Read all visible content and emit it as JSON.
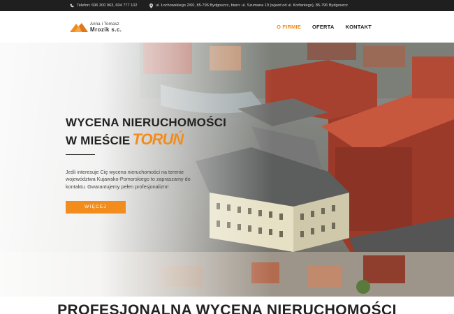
{
  "topbar": {
    "phone_text": "Telefon: 696 300 963, 604 777 102",
    "address_text": "ul. Łochowskiego 2/60, 85-796 Bydgoszcz, biuro: ul. Szumana 19 (wjazd od ul. Korfantego), 85-796 Bydgoszcz"
  },
  "logo": {
    "line1": "Anna i Tomasz",
    "line2": "Mrozik s.c."
  },
  "nav": {
    "items": [
      {
        "label": "O FIRMIE",
        "active": true
      },
      {
        "label": "OFERTA",
        "active": false
      },
      {
        "label": "KONTAKT",
        "active": false
      }
    ]
  },
  "hero": {
    "title_line1": "WYCENA NIERUCHOMOŚCI",
    "title_line2": "W MIEŚCIE",
    "city": "TORUŃ",
    "description": "Jeśli interesuje Cię wycena nieruchomości na terenie województwa Kujawsko-Pomorskiego to zapraszamy do kontaktu. Gwarantujemy pełen profesjonalizm!",
    "button_label": "WIĘCEJ"
  },
  "section": {
    "title": "PROFESJONALNA WYCENA NIERUCHOMOŚCI"
  },
  "colors": {
    "accent": "#f28c1c",
    "topbar_bg": "#1f1f1f",
    "text_dark": "#222222"
  }
}
